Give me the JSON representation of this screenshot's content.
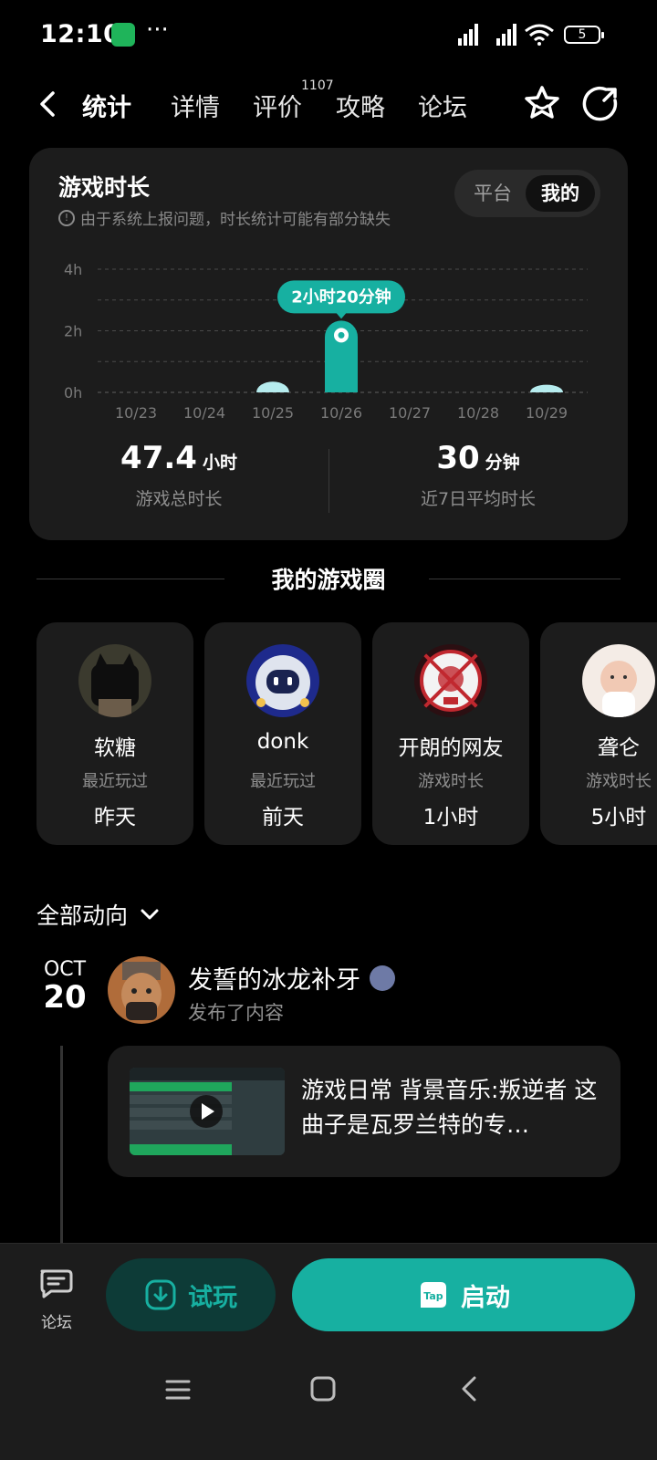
{
  "status_bar": {
    "time": "12:10",
    "battery": "5"
  },
  "nav": {
    "tabs": [
      {
        "label": "统计"
      },
      {
        "label": "详情"
      },
      {
        "label": "评价"
      },
      {
        "label": "攻略"
      },
      {
        "label": "论坛"
      }
    ],
    "review_count": "1107"
  },
  "playtime": {
    "title": "游戏时长",
    "note": "由于系统上报问题，时长统计可能有部分缺失",
    "toggle": [
      "平台",
      "我的"
    ],
    "tooltip": "2小时20分钟",
    "total_value": "47.4",
    "total_unit": "小时",
    "total_label": "游戏总时长",
    "avg_value": "30",
    "avg_unit": "分钟",
    "avg_label": "近7日平均时长"
  },
  "chart_data": {
    "type": "bar",
    "categories": [
      "10/23",
      "10/24",
      "10/25",
      "10/26",
      "10/27",
      "10/28",
      "10/29"
    ],
    "values": [
      0,
      0,
      0.35,
      2.33,
      0,
      0,
      0.25
    ],
    "yticks": [
      "4h",
      "2h",
      "0h"
    ],
    "ylim": [
      0,
      4
    ],
    "highlight_index": 3,
    "colors": {
      "highlight": "#17b0a1",
      "normal": "#b6ecee"
    }
  },
  "circle": {
    "title": "我的游戏圈",
    "friends": [
      {
        "name": "软糖",
        "sub": "最近玩过",
        "value": "昨天"
      },
      {
        "name": "donk",
        "sub": "最近玩过",
        "value": "前天"
      },
      {
        "name": "开朗的网友",
        "sub": "游戏时长",
        "value": "1小时"
      },
      {
        "name": "聋仑",
        "sub": "游戏时长",
        "value": "5小时"
      }
    ]
  },
  "feed": {
    "filter": "全部动向",
    "month": "OCT",
    "day": "20",
    "user": "发誓的冰龙补牙",
    "action": "发布了内容",
    "post_text": "游戏日常 背景音乐:叛逆者 这曲子是瓦罗兰特的专…"
  },
  "bottom": {
    "forum": "论坛",
    "try": "试玩",
    "start": "启动"
  }
}
